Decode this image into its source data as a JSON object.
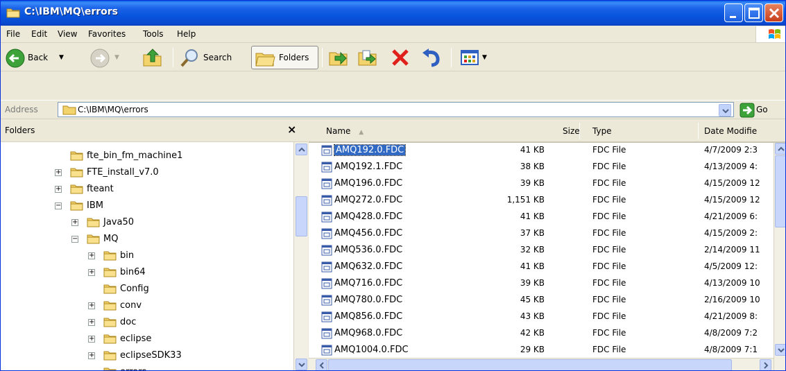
{
  "window": {
    "title": "C:\\IBM\\MQ\\errors",
    "accent": "#0A54E0",
    "close_color": "#D3542A"
  },
  "menu": [
    "File",
    "Edit",
    "View",
    "Favorites",
    "Tools",
    "Help"
  ],
  "toolbar": {
    "back_label": "Back",
    "search_label": "Search",
    "folders_label": "Folders"
  },
  "address": {
    "label": "Address",
    "value": "C:\\IBM\\MQ\\errors",
    "go_label": "Go"
  },
  "folders_pane": {
    "title": "Folders",
    "close_glyph": "×",
    "tree": [
      {
        "label": "fte_bin_fm_machine1",
        "level": 1,
        "expander": ""
      },
      {
        "label": "FTE_install_v7.0",
        "level": 1,
        "expander": "+"
      },
      {
        "label": "fteant",
        "level": 1,
        "expander": "+"
      },
      {
        "label": "IBM",
        "level": 1,
        "expander": "−"
      },
      {
        "label": "Java50",
        "level": 2,
        "expander": "+"
      },
      {
        "label": "MQ",
        "level": 2,
        "expander": "−"
      },
      {
        "label": "bin",
        "level": 3,
        "expander": "+"
      },
      {
        "label": "bin64",
        "level": 3,
        "expander": "+"
      },
      {
        "label": "Config",
        "level": 3,
        "expander": ""
      },
      {
        "label": "conv",
        "level": 3,
        "expander": "+"
      },
      {
        "label": "doc",
        "level": 3,
        "expander": "+"
      },
      {
        "label": "eclipse",
        "level": 3,
        "expander": "+"
      },
      {
        "label": "eclipseSDK33",
        "level": 3,
        "expander": "+"
      },
      {
        "label": "errors",
        "level": 3,
        "expander": ""
      }
    ]
  },
  "file_list": {
    "columns": {
      "name": "Name",
      "size": "Size",
      "type": "Type",
      "date": "Date Modifie"
    },
    "sort_indicator": "▲",
    "selected_index": 0,
    "selected_color": "#316AC5",
    "rows": [
      {
        "name": "AMQ192.0.FDC",
        "size": "41 KB",
        "type": "FDC File",
        "date": "4/7/2009 2:3"
      },
      {
        "name": "AMQ192.1.FDC",
        "size": "38 KB",
        "type": "FDC File",
        "date": "4/13/2009 4:"
      },
      {
        "name": "AMQ196.0.FDC",
        "size": "39 KB",
        "type": "FDC File",
        "date": "4/15/2009 12"
      },
      {
        "name": "AMQ272.0.FDC",
        "size": "1,151 KB",
        "type": "FDC File",
        "date": "4/15/2009 12"
      },
      {
        "name": "AMQ428.0.FDC",
        "size": "41 KB",
        "type": "FDC File",
        "date": "4/21/2009 6:"
      },
      {
        "name": "AMQ456.0.FDC",
        "size": "37 KB",
        "type": "FDC File",
        "date": "4/15/2009 2:"
      },
      {
        "name": "AMQ536.0.FDC",
        "size": "32 KB",
        "type": "FDC File",
        "date": "2/14/2009 11"
      },
      {
        "name": "AMQ632.0.FDC",
        "size": "41 KB",
        "type": "FDC File",
        "date": "4/5/2009 12:"
      },
      {
        "name": "AMQ716.0.FDC",
        "size": "39 KB",
        "type": "FDC File",
        "date": "4/13/2009 10"
      },
      {
        "name": "AMQ780.0.FDC",
        "size": "45 KB",
        "type": "FDC File",
        "date": "2/16/2009 10"
      },
      {
        "name": "AMQ856.0.FDC",
        "size": "43 KB",
        "type": "FDC File",
        "date": "4/21/2009 8:"
      },
      {
        "name": "AMQ968.0.FDC",
        "size": "42 KB",
        "type": "FDC File",
        "date": "4/8/2009 7:2"
      },
      {
        "name": "AMQ1004.0.FDC",
        "size": "29 KB",
        "type": "FDC File",
        "date": "4/8/2009 7:1"
      }
    ]
  }
}
